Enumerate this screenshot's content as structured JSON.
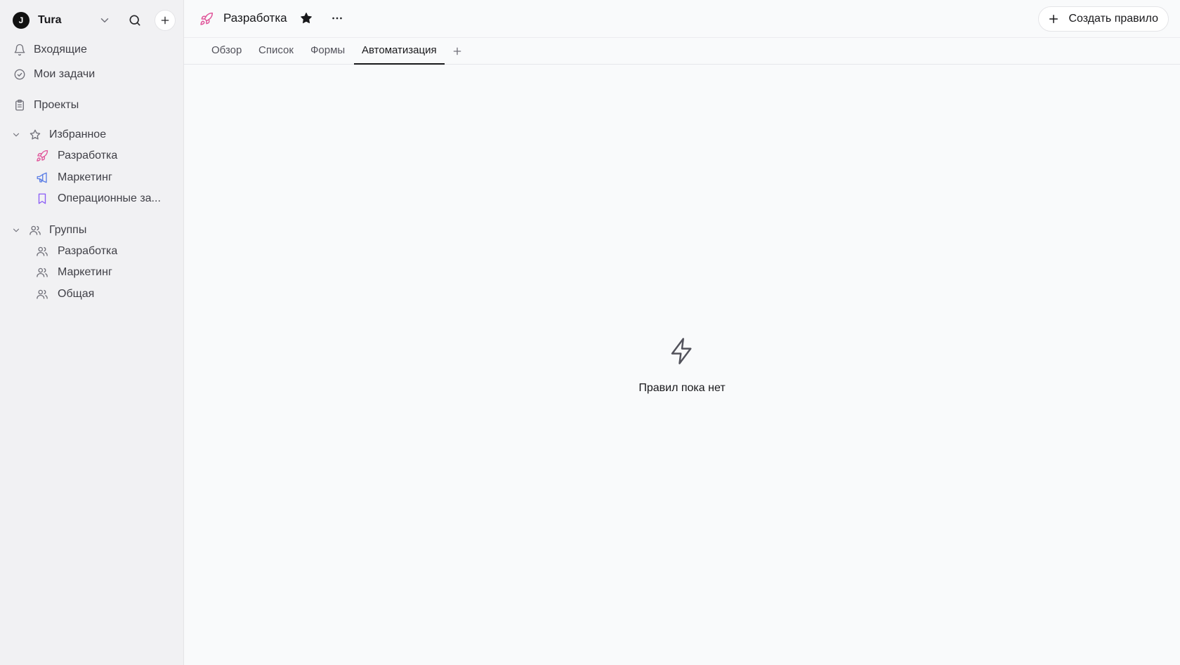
{
  "workspace": {
    "logo": "J",
    "name": "Tura"
  },
  "sidebar": {
    "inbox": {
      "label": "Входящие",
      "icon": "bell-icon"
    },
    "my_tasks": {
      "label": "Мои задачи",
      "icon": "check-circle-icon"
    },
    "projects": {
      "label": "Проекты",
      "icon": "clipboard-icon"
    },
    "favorites": {
      "label": "Избранное",
      "items": [
        {
          "label": "Разработка",
          "icon": "rocket-icon",
          "color": "#e0559a"
        },
        {
          "label": "Маркетинг",
          "icon": "megaphone-icon",
          "color": "#5b7ee5"
        },
        {
          "label": "Операционные за...",
          "icon": "bookmark-icon",
          "color": "#8b5cf6"
        }
      ]
    },
    "groups": {
      "label": "Группы",
      "items": [
        {
          "label": "Разработка",
          "icon": "users-icon"
        },
        {
          "label": "Маркетинг",
          "icon": "users-icon"
        },
        {
          "label": "Общая",
          "icon": "users-icon"
        }
      ]
    }
  },
  "header": {
    "project_title": "Разработка",
    "create_rule_label": "Создать правило"
  },
  "tabs": [
    {
      "label": "Обзор"
    },
    {
      "label": "Список"
    },
    {
      "label": "Формы"
    },
    {
      "label": "Автоматизация",
      "active": true
    }
  ],
  "empty_state": {
    "icon": "lightning-icon",
    "text": "Правил пока нет"
  },
  "colors": {
    "accent_rocket": "#e0559a",
    "sidebar_bg": "#f1f1f3",
    "main_bg": "#f9fafb"
  }
}
